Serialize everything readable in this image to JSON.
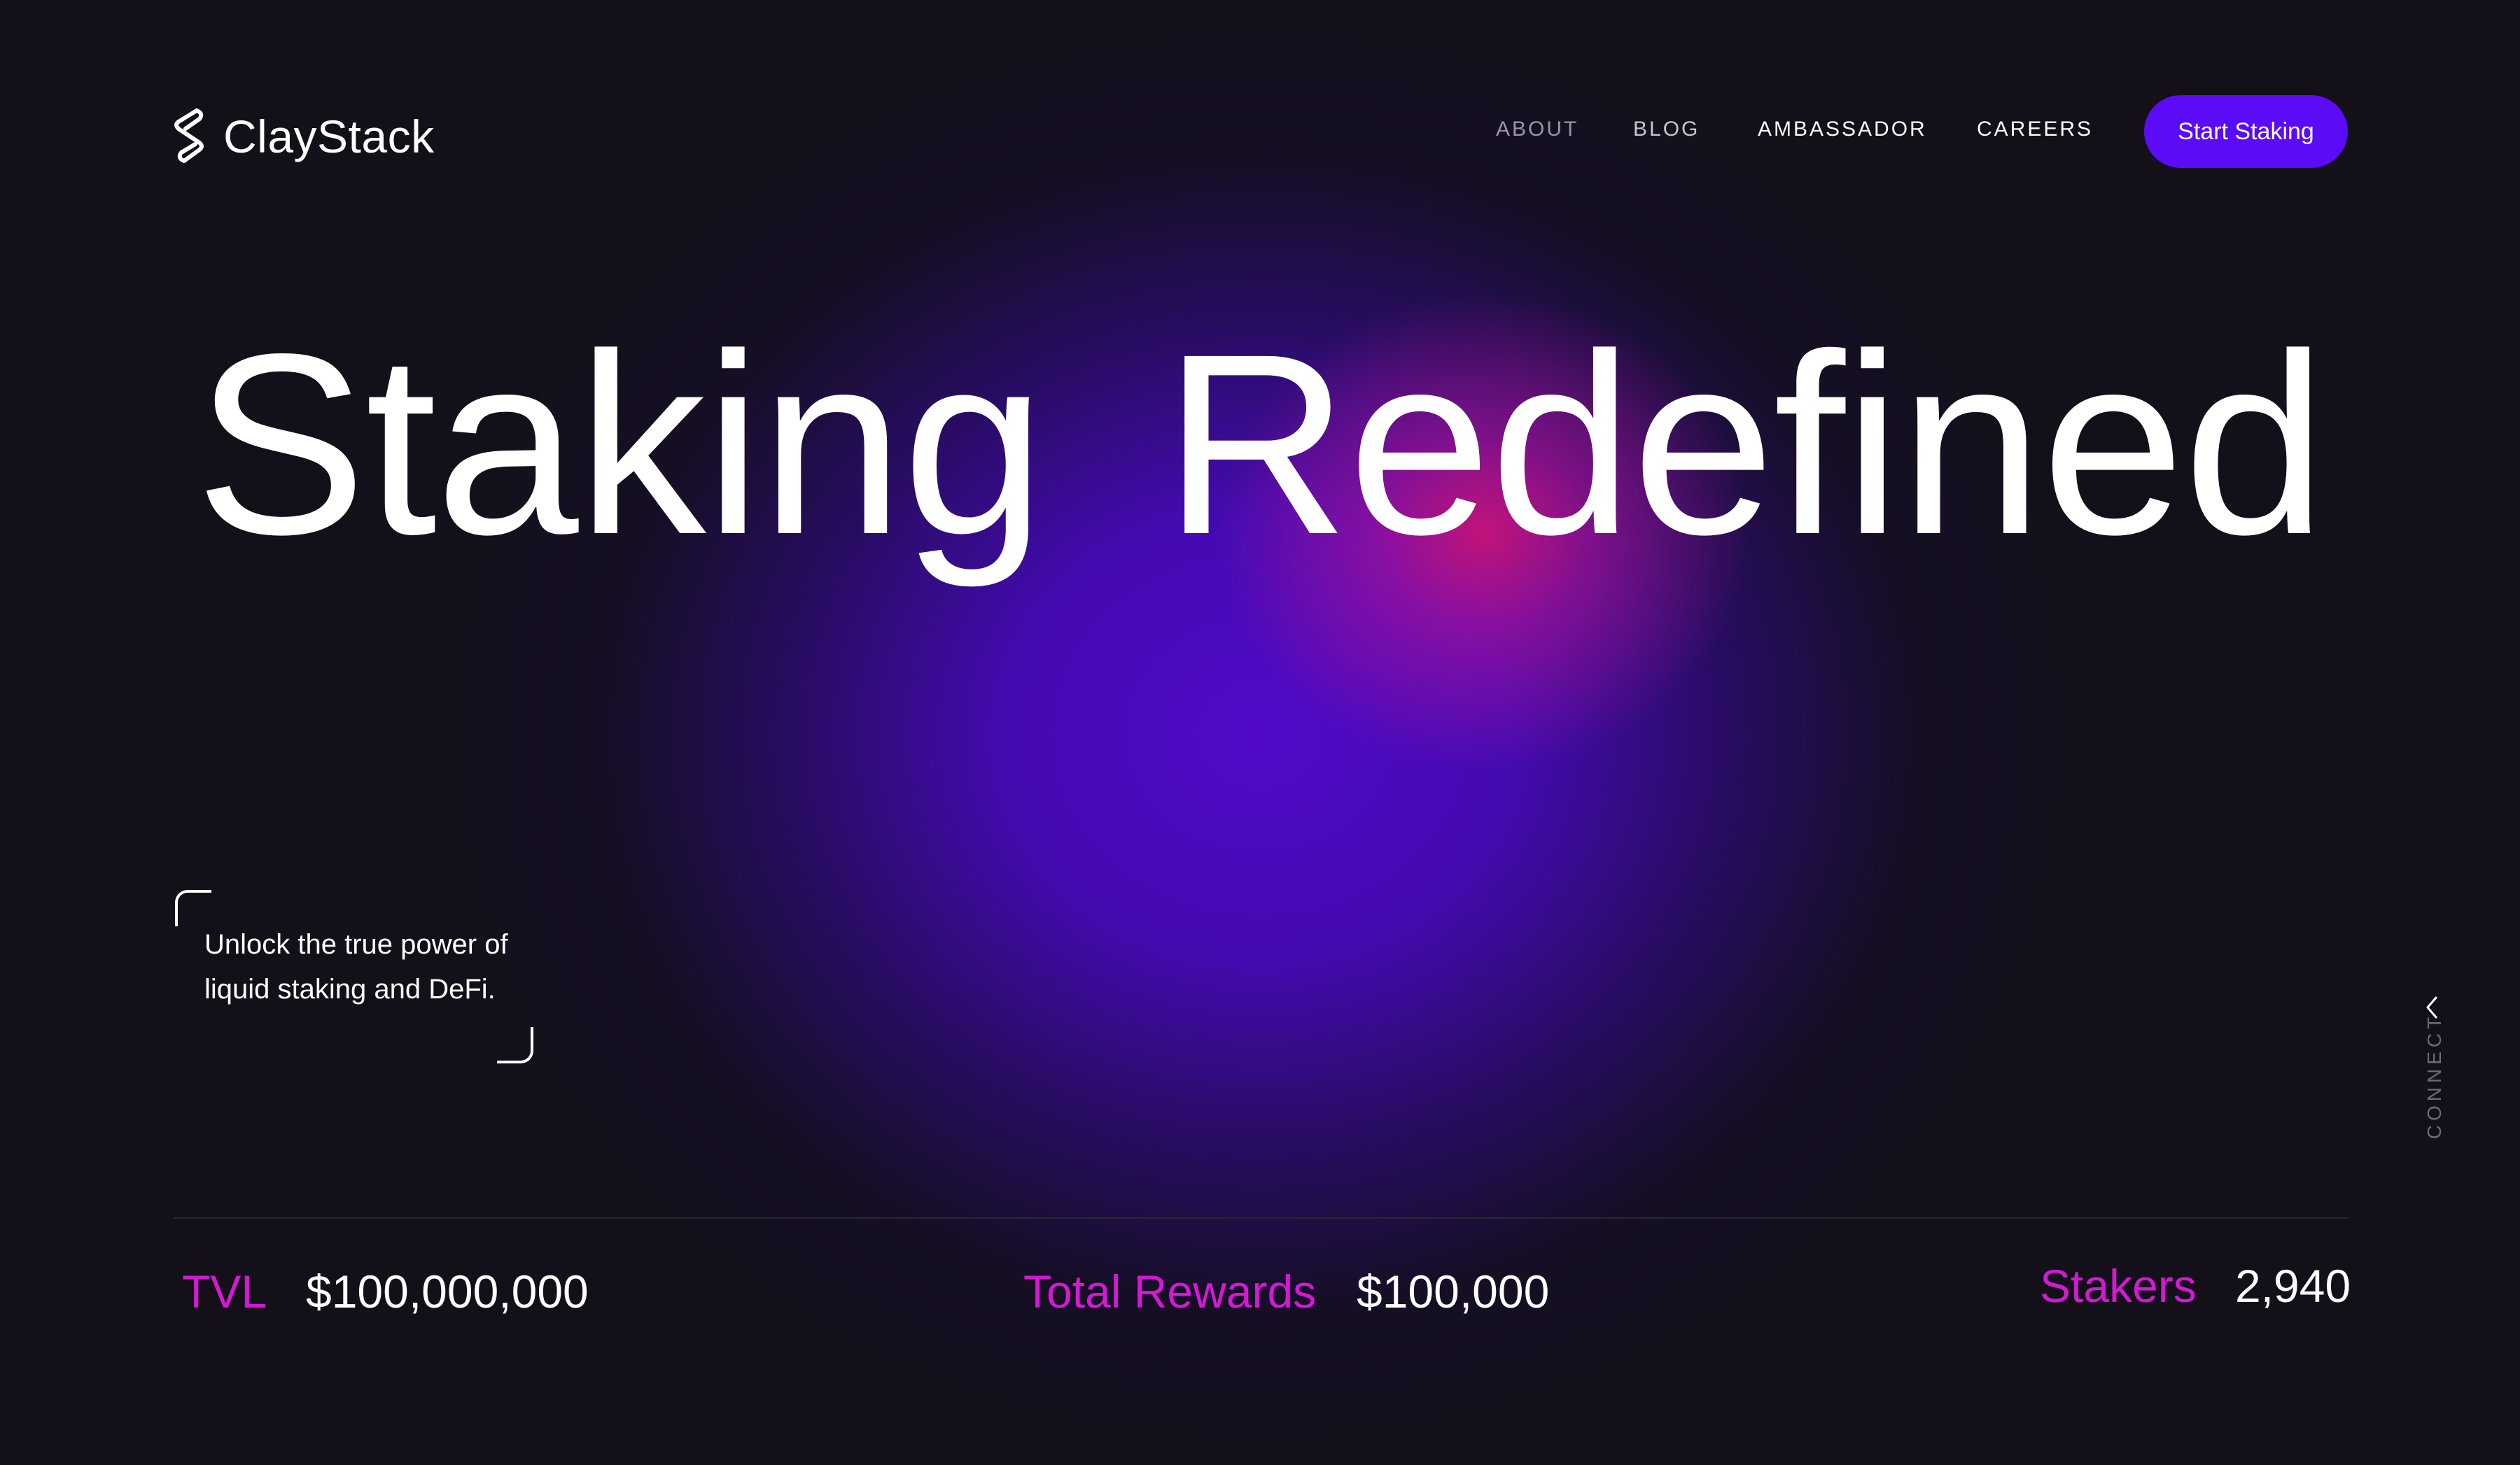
{
  "brand": {
    "name": "ClayStack",
    "logo_icon": "claystack-s-icon"
  },
  "nav": {
    "items": [
      {
        "label": "ABOUT"
      },
      {
        "label": "BLOG"
      },
      {
        "label": "AMBASSADOR"
      },
      {
        "label": "CAREERS"
      }
    ],
    "cta_label": "Start Staking"
  },
  "hero": {
    "title": "Staking  Redefined",
    "tagline": "Unlock the true power of liquid staking and DeFi."
  },
  "side": {
    "connect_label": "CONNECT",
    "chevron_icon": "chevron-left-icon"
  },
  "stats": [
    {
      "label": "TVL",
      "value": "$100,000,000"
    },
    {
      "label": "Total Rewards",
      "value": "$100,000"
    },
    {
      "label": "Stakers",
      "value": "2,940"
    }
  ],
  "colors": {
    "background": "#13101a",
    "accent": "#5b0bf5",
    "stat_label": "#d419d4",
    "glow_purple": "#520ac8",
    "glow_pink": "#c81478"
  }
}
